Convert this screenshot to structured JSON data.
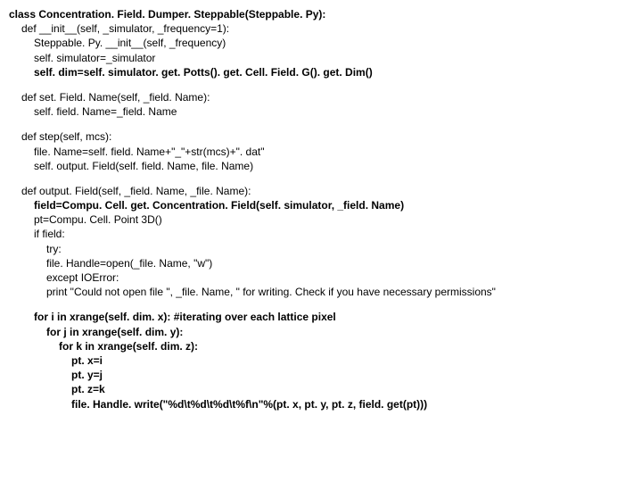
{
  "code": {
    "l0": "class Concentration. Field. Dumper. Steppable(Steppable. Py):",
    "l1": "def __init__(self, _simulator, _frequency=1):",
    "l2": "Steppable. Py. __init__(self, _frequency)",
    "l3": "self. simulator=_simulator",
    "l4": "self. dim=self. simulator. get. Potts(). get. Cell. Field. G(). get. Dim()",
    "l5": "def set. Field. Name(self, _field. Name):",
    "l6": "self. field. Name=_field. Name",
    "l7": "def step(self, mcs):",
    "l8": "file. Name=self. field. Name+\"_\"+str(mcs)+\". dat\"",
    "l9": "self. output. Field(self. field. Name, file. Name)",
    "l10": "def output. Field(self, _field. Name, _file. Name):",
    "l11": "field=Compu. Cell. get. Concentration. Field(self. simulator, _field. Name)",
    "l12": "pt=Compu. Cell. Point 3D()",
    "l13": "if field:",
    "l14": "try:",
    "l15": "file. Handle=open(_file. Name, \"w\")",
    "l16": "except IOError:",
    "l17": "print \"Could not open file \", _file. Name, \" for writing. Check if you have necessary permissions\"",
    "l18": "for i in xrange(self. dim. x): #iterating over each lattice pixel",
    "l19": "for j in xrange(self. dim. y):",
    "l20": "for k in xrange(self. dim. z):",
    "l21": "pt. x=i",
    "l22": "pt. y=j",
    "l23": "pt. z=k",
    "l24": "file. Handle. write(\"%d\\t%d\\t%d\\t%f\\n\"%(pt. x, pt. y, pt. z, field. get(pt)))"
  }
}
